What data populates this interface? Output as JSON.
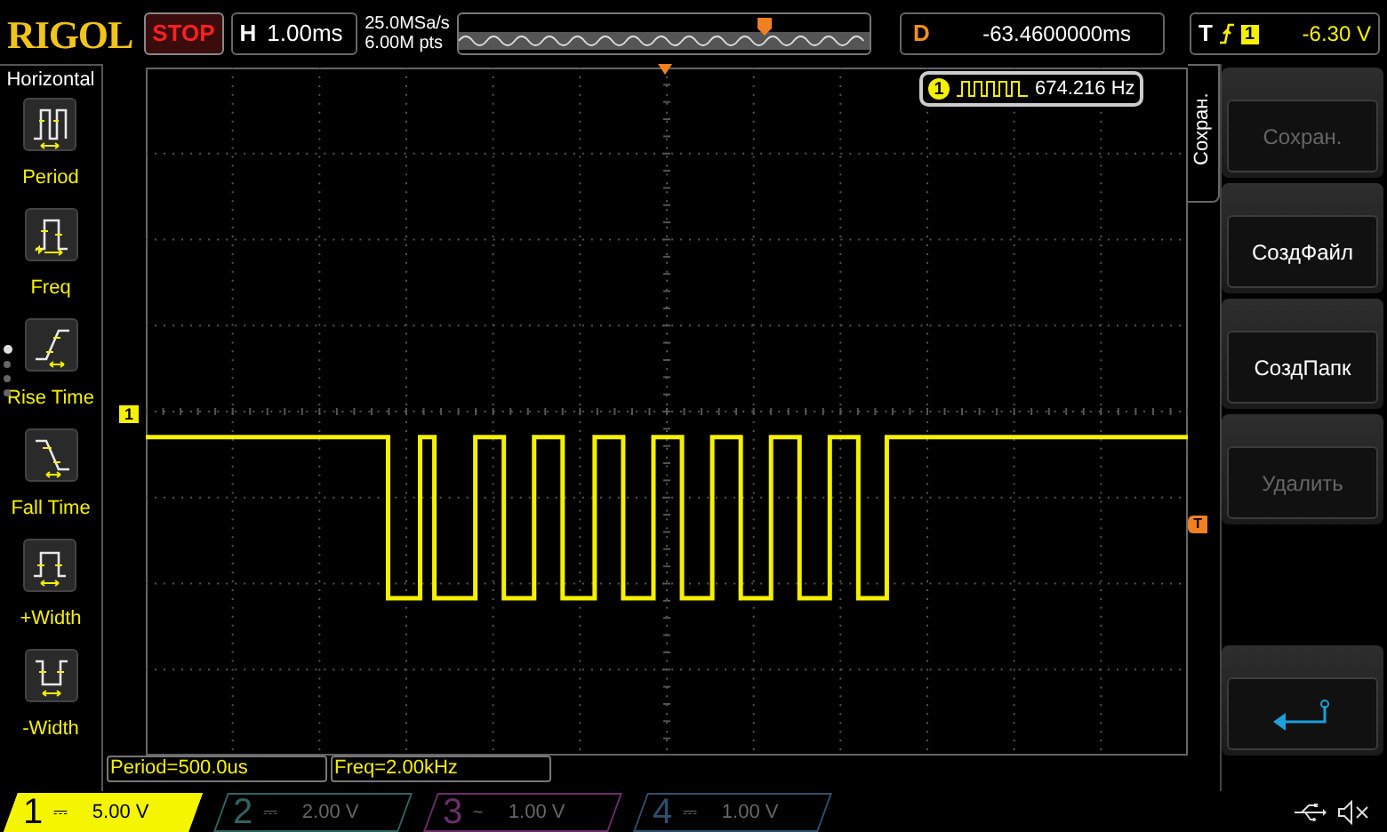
{
  "header": {
    "logo": "RIGOL",
    "run_state": "STOP",
    "timebase": {
      "label": "H",
      "value": "1.00ms"
    },
    "sample_rate": "25.0MSa/s",
    "memory_depth": "6.00M pts",
    "delay": {
      "label": "D",
      "value": "-63.4600000ms"
    },
    "trigger": {
      "label": "T",
      "channel": "1",
      "level": "-6.30 V"
    }
  },
  "measure_menu": {
    "title": "Horizontal",
    "items": [
      {
        "label": "Period",
        "kind": "period"
      },
      {
        "label": "Freq",
        "kind": "freq"
      },
      {
        "label": "Rise Time",
        "kind": "rise"
      },
      {
        "label": "Fall Time",
        "kind": "fall"
      },
      {
        "label": "+Width",
        "kind": "pwidth"
      },
      {
        "label": "-Width",
        "kind": "nwidth"
      }
    ],
    "pages": [
      {
        "selected": true
      },
      {
        "selected": false
      },
      {
        "selected": false
      },
      {
        "selected": false
      }
    ]
  },
  "screen": {
    "channel_marker": "1",
    "trigger_marker": "T",
    "frequency_readout": {
      "channel": "1",
      "value": "674.216 Hz"
    }
  },
  "measurements": [
    "Period=500.0us",
    "Freq=2.00kHz"
  ],
  "softkey_menu": {
    "title": "Сохран.",
    "items": [
      {
        "kind": "text",
        "label": "Сохран.",
        "disabled": true
      },
      {
        "kind": "text",
        "label": "СоздФайл",
        "disabled": false
      },
      {
        "kind": "text",
        "label": "СоздПапк",
        "disabled": false
      },
      {
        "kind": "text",
        "label": "Удалить",
        "disabled": true
      },
      {
        "kind": "spacer"
      },
      {
        "kind": "back",
        "disabled": false
      }
    ]
  },
  "channels": [
    {
      "number": "1",
      "coupling": "⎓",
      "scale": "5.00 V",
      "active": true,
      "color": "#f5f500"
    },
    {
      "number": "2",
      "coupling": "⎓",
      "scale": "2.00 V",
      "active": false,
      "color": "#2f6461"
    },
    {
      "number": "3",
      "coupling": "~",
      "scale": "1.00 V",
      "active": false,
      "color": "#6b2f6b"
    },
    {
      "number": "4",
      "coupling": "⎓",
      "scale": "1.00 V",
      "active": false,
      "color": "#2f4f6e"
    }
  ]
}
